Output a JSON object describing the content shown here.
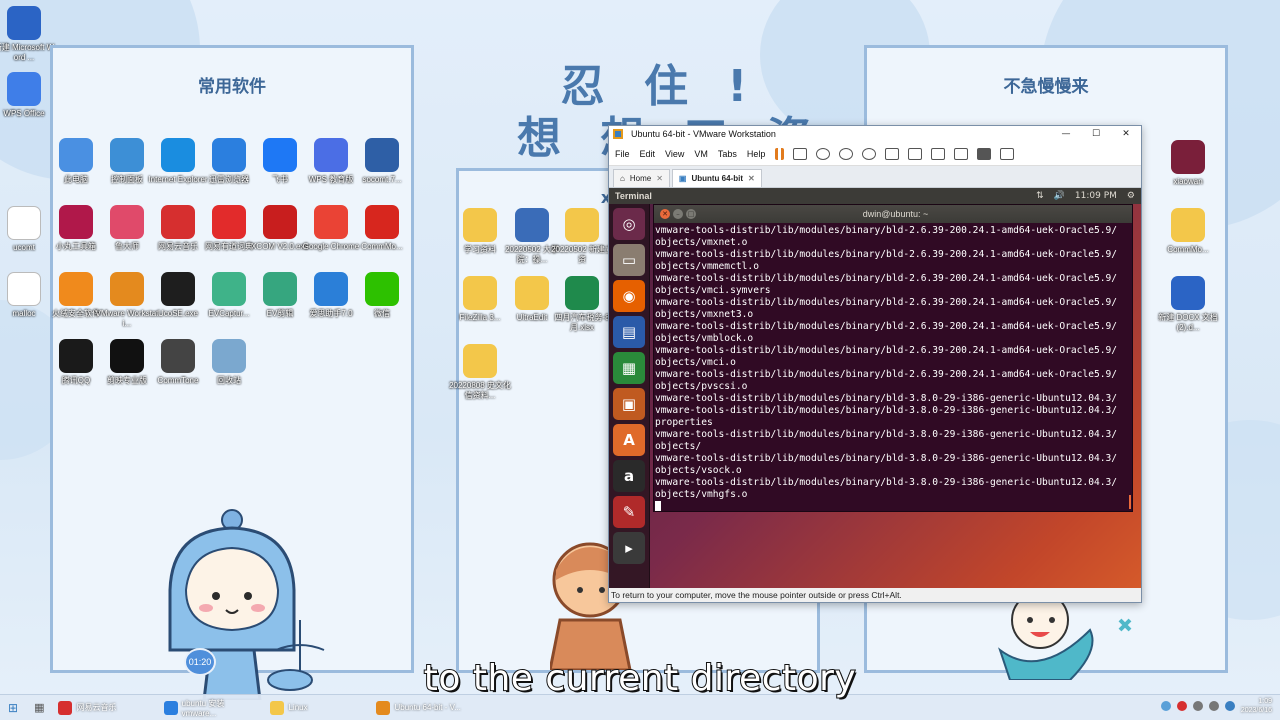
{
  "desktop": {
    "left_icons": [
      {
        "label": "新建 Microsoft Word ...",
        "icon": "word-doc-icon",
        "color": "#2b64c5"
      },
      {
        "label": "WPS Office",
        "icon": "wps-office-icon",
        "color": "#3f7ee8"
      },
      {
        "label": "ucomt",
        "icon": "file-icon",
        "color": "#ffffff"
      },
      {
        "label": "malloc",
        "icon": "file-icon",
        "color": "#ffffff"
      }
    ],
    "panel_left": {
      "title": "常用软件",
      "icons": [
        {
          "label": "此电脑",
          "icon": "computer-icon",
          "color": "#4a90e2"
        },
        {
          "label": "控制面板",
          "icon": "control-panel-icon",
          "color": "#3d8fd6"
        },
        {
          "label": "Internet Explorer",
          "icon": "ie-icon",
          "color": "#1a8de0"
        },
        {
          "label": "迅雷浏览器",
          "icon": "browser-icon",
          "color": "#2b7fdf"
        },
        {
          "label": "飞书",
          "icon": "feishu-icon",
          "color": "#1e78f5"
        },
        {
          "label": "WPS 教育版",
          "icon": "wps-icon",
          "color": "#4b6ee5"
        },
        {
          "label": "socomt.7...",
          "icon": "building-icon",
          "color": "#2e5fa6"
        },
        {
          "label": "小丸工具箱",
          "icon": "toolbox-icon",
          "color": "#b0184a"
        },
        {
          "label": "鲁大师",
          "icon": "master-icon",
          "color": "#e04a6a"
        },
        {
          "label": "网易云音乐",
          "icon": "music-icon",
          "color": "#d62f2f"
        },
        {
          "label": "网易有道词典",
          "icon": "youdao-icon",
          "color": "#e22b2b"
        },
        {
          "label": "XCOM V2.0.exe",
          "icon": "xcom-icon",
          "color": "#c81e1e"
        },
        {
          "label": "Google Chrome",
          "icon": "chrome-icon",
          "color": "#ea4335"
        },
        {
          "label": "CommMo...",
          "icon": "commmo-icon",
          "color": "#d7261e"
        },
        {
          "label": "火绒安全软件",
          "icon": "huorong-icon",
          "color": "#f08a1c"
        },
        {
          "label": "VMware Workstati...",
          "icon": "vmware-icon",
          "color": "#e48a1e"
        },
        {
          "label": "UcoSE.exe",
          "icon": "ue-icon",
          "color": "#1e1e1e"
        },
        {
          "label": "EVCaptur...",
          "icon": "evcapture-icon",
          "color": "#3fb389"
        },
        {
          "label": "EV剪辑",
          "icon": "evedit-icon",
          "color": "#36a67f"
        },
        {
          "label": "爱思助手7.0",
          "icon": "i4-icon",
          "color": "#2b7fd8"
        },
        {
          "label": "微信",
          "icon": "wechat-icon",
          "color": "#2dc100"
        },
        {
          "label": "腾讯QQ",
          "icon": "qq-icon",
          "color": "#1a1a1a"
        },
        {
          "label": "剪映专业版",
          "icon": "capcut-icon",
          "color": "#111111"
        },
        {
          "label": "CommTone",
          "icon": "commtone-icon",
          "color": "#444444"
        },
        {
          "label": "回收站",
          "icon": "recycle-bin-icon",
          "color": "#7ba8cf"
        }
      ]
    },
    "panel_mid_title": "忍住！想想工资！",
    "panel_mid_title_line1": "忍 住 !",
    "panel_mid_title_line2": "想 想 工 资 !",
    "panel_mid": {
      "title_short": "x",
      "icons": [
        {
          "label": "学习资料",
          "icon": "folder-icon",
          "color": "#f3c74a"
        },
        {
          "label": "20220502 大学院：操...",
          "icon": "folder-icon",
          "color": "#3a6cb8"
        },
        {
          "label": "20220502 新建立资",
          "icon": "folder-icon",
          "color": "#f3c74a"
        },
        {
          "label": "FileZilla 3...",
          "icon": "folder-icon",
          "color": "#f3c74a"
        },
        {
          "label": "UltraEdit",
          "icon": "folder-icon",
          "color": "#f3c74a"
        },
        {
          "label": "四月汽车税务-8月.xlsx",
          "icon": "excel-icon",
          "color": "#1f8a4c"
        },
        {
          "label": "20220808 史文化信资料...",
          "icon": "folder-icon",
          "color": "#f3c74a"
        }
      ]
    },
    "panel_right": {
      "title": "不急慢慢来",
      "icons": [
        {
          "label": "xiaowan",
          "icon": "book-icon",
          "color": "#7a1f3a"
        },
        {
          "label": "CommMo...",
          "icon": "folder-icon",
          "color": "#f3c74a"
        },
        {
          "label": "新建 DOCX 文档 (2).d...",
          "icon": "word-doc-icon",
          "color": "#2b64c5"
        }
      ]
    }
  },
  "vmware": {
    "title": "Ubuntu 64-bit - VMware Workstation",
    "menu": [
      "File",
      "Edit",
      "View",
      "VM",
      "Tabs",
      "Help"
    ],
    "tabs": [
      {
        "label": "Home",
        "active": false
      },
      {
        "label": "Ubuntu 64-bit",
        "active": true
      }
    ],
    "status": "To return to your computer, move the mouse pointer outside or press Ctrl+Alt."
  },
  "ubuntu": {
    "app_name": "Terminal",
    "time": "11:09 PM",
    "terminal_title": "dwin@ubuntu: ~",
    "lines": [
      "vmware-tools-distrib/lib/modules/binary/bld-2.6.39-200.24.1-amd64-uek-Oracle5.9/",
      "objects/vmxnet.o",
      "vmware-tools-distrib/lib/modules/binary/bld-2.6.39-200.24.1-amd64-uek-Oracle5.9/",
      "objects/vmmemctl.o",
      "vmware-tools-distrib/lib/modules/binary/bld-2.6.39-200.24.1-amd64-uek-Oracle5.9/",
      "objects/vmci.symvers",
      "vmware-tools-distrib/lib/modules/binary/bld-2.6.39-200.24.1-amd64-uek-Oracle5.9/",
      "objects/vmxnet3.o",
      "vmware-tools-distrib/lib/modules/binary/bld-2.6.39-200.24.1-amd64-uek-Oracle5.9/",
      "objects/vmblock.o",
      "vmware-tools-distrib/lib/modules/binary/bld-2.6.39-200.24.1-amd64-uek-Oracle5.9/",
      "objects/vmci.o",
      "vmware-tools-distrib/lib/modules/binary/bld-2.6.39-200.24.1-amd64-uek-Oracle5.9/",
      "objects/pvscsi.o",
      "vmware-tools-distrib/lib/modules/binary/bld-3.8.0-29-i386-generic-Ubuntu12.04.3/",
      "vmware-tools-distrib/lib/modules/binary/bld-3.8.0-29-i386-generic-Ubuntu12.04.3/",
      "properties",
      "vmware-tools-distrib/lib/modules/binary/bld-3.8.0-29-i386-generic-Ubuntu12.04.3/",
      "objects/",
      "vmware-tools-distrib/lib/modules/binary/bld-3.8.0-29-i386-generic-Ubuntu12.04.3/",
      "objects/vsock.o",
      "vmware-tools-distrib/lib/modules/binary/bld-3.8.0-29-i386-generic-Ubuntu12.04.3/",
      "objects/vmhgfs.o"
    ],
    "launcher": [
      {
        "icon": "ubuntu-dash-icon",
        "color": "#6b2a4a",
        "glyph": "◎"
      },
      {
        "icon": "files-icon",
        "color": "#8a7d70",
        "glyph": "▭"
      },
      {
        "icon": "firefox-icon",
        "color": "#e66000",
        "glyph": "◉"
      },
      {
        "icon": "writer-icon",
        "color": "#2a5aa8",
        "glyph": "▤"
      },
      {
        "icon": "calc-icon",
        "color": "#2a8a3a",
        "glyph": "▦"
      },
      {
        "icon": "impress-icon",
        "color": "#c05a20",
        "glyph": "▣"
      },
      {
        "icon": "software-center-icon",
        "color": "#e06a2a",
        "glyph": "A"
      },
      {
        "icon": "amazon-icon",
        "color": "#2a2a2a",
        "glyph": "a"
      },
      {
        "icon": "settings-icon",
        "color": "#b02a2a",
        "glyph": "✎"
      },
      {
        "icon": "terminal-icon",
        "color": "#3a3a3a",
        "glyph": "▸"
      }
    ]
  },
  "taskbar": {
    "items": [
      {
        "label": "网易云音乐",
        "icon": "music-icon",
        "color": "#d62f2f"
      },
      {
        "label": "ubuntu 安装 vmware...",
        "icon": "browser-icon",
        "color": "#2b7fdf"
      },
      {
        "label": "Linux",
        "icon": "folder-icon",
        "color": "#f3c74a"
      },
      {
        "label": "Ubuntu 64-bit - V...",
        "icon": "vmware-icon",
        "color": "#e48a1e"
      }
    ],
    "clock_time": "1:09",
    "clock_date": "2023/6/16"
  },
  "video": {
    "subtitle": "to the current directory",
    "time_badge": "01:20"
  }
}
